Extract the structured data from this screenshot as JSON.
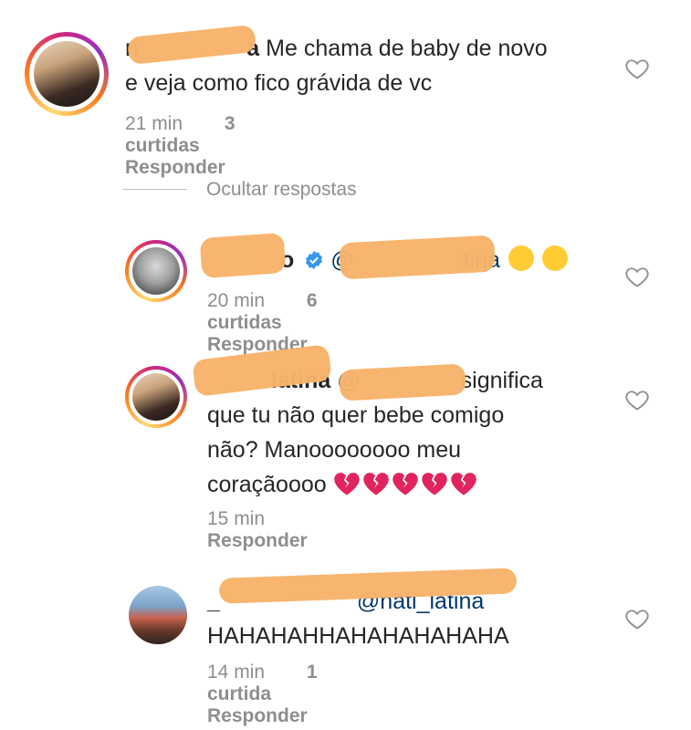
{
  "comments": [
    {
      "username": "n",
      "username_suffix": "a",
      "text_line1": "Me chama de baby de novo",
      "text_line2": "e veja como fico grávida de vc",
      "time": "21 min",
      "likes": "3 curtidas",
      "reply": "Responder"
    },
    {
      "username": "o",
      "mention": "@",
      "mention_suffix": "tina",
      "time": "20 min",
      "likes": "6 curtidas",
      "reply": "Responder"
    },
    {
      "username": "latina",
      "mention": "@",
      "text_line1": "significa",
      "text_line2": "que tu não quer bebe comigo",
      "text_line3": "não? Manoooooooo meu",
      "text_line4": "coraçãoooo",
      "time": "15 min",
      "reply": "Responder"
    },
    {
      "username": "_",
      "mention": "@nati_latina",
      "text_line1": "HAHAHAHHAHAHAHAHAHA",
      "time": "14 min",
      "likes": "1 curtida",
      "reply": "Responder"
    }
  ],
  "hide_replies_label": "Ocultar respostas",
  "colors": {
    "redaction": "#f7b36a",
    "meta_gray": "#8e8e8e",
    "verified_blue": "#3897f0"
  },
  "icons": [
    "heart-outline-icon",
    "verified-badge-icon",
    "laughing-tears-emoji",
    "broken-heart-emoji"
  ]
}
